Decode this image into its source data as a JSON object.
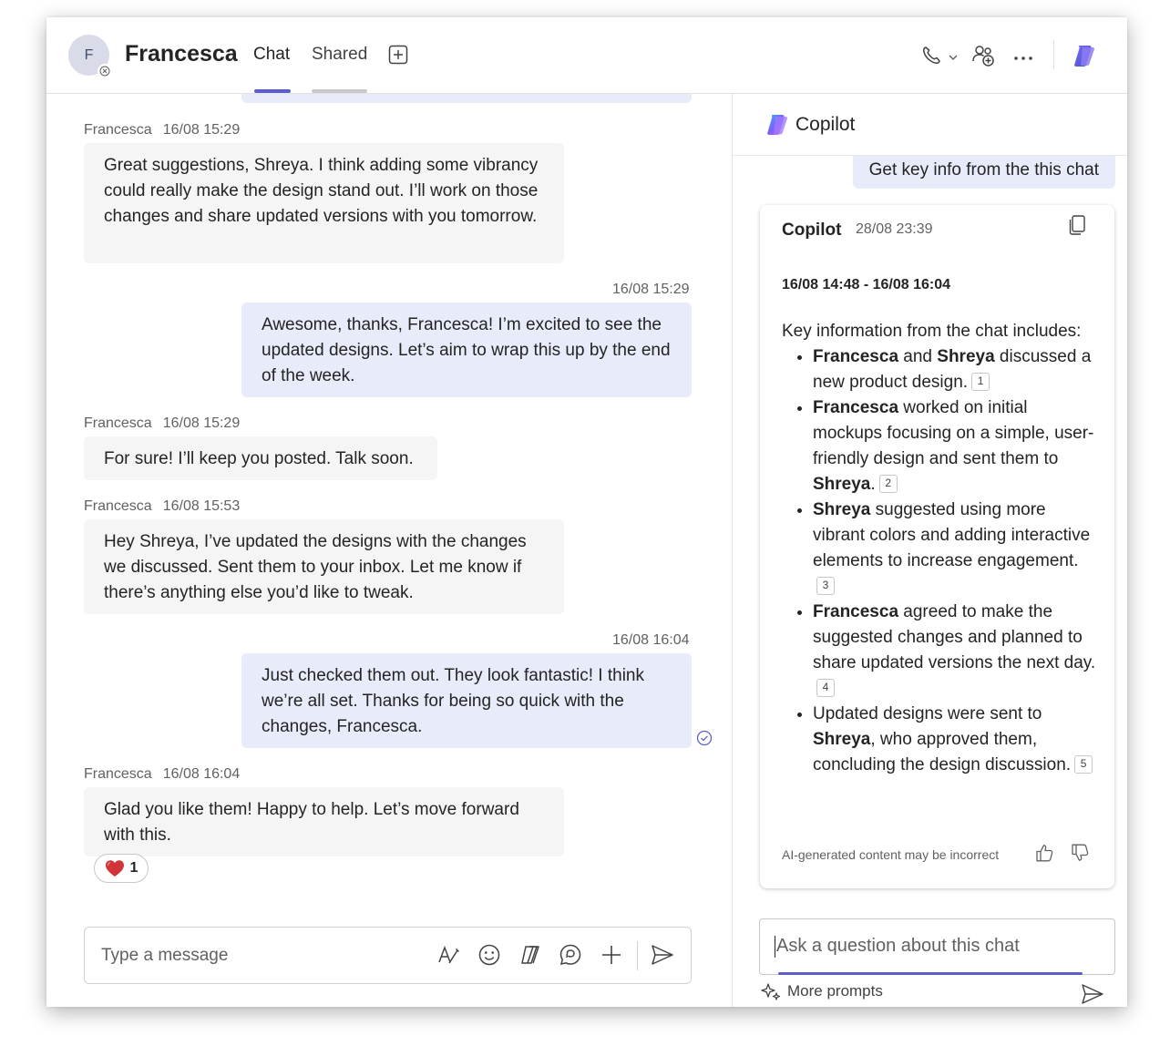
{
  "header": {
    "avatar_initial": "F",
    "contact_name": "Francesca",
    "tabs": [
      {
        "label": "Chat",
        "active": true
      },
      {
        "label": "Shared",
        "active": false
      }
    ],
    "icons": [
      "add-tab-icon",
      "phone-icon",
      "chevron-down-icon",
      "add-people-icon",
      "more-icon",
      "copilot-icon"
    ]
  },
  "chat": {
    "messages": [
      {
        "sender": "Francesca",
        "time": "16/08 15:29",
        "direction": "in",
        "text": "Great suggestions, Shreya. I think adding some vibrancy could really make the design stand out. I’ll work on those changes and share updated versions with you tomorrow."
      },
      {
        "sender": "",
        "time": "16/08 15:29",
        "direction": "out",
        "text": "Awesome, thanks, Francesca! I’m excited to see the updated designs. Let’s aim to wrap this up by the end of the week."
      },
      {
        "sender": "Francesca",
        "time": "16/08 15:29",
        "direction": "in",
        "text": "For sure! I’ll keep you posted. Talk soon."
      },
      {
        "sender": "Francesca",
        "time": "16/08 15:53",
        "direction": "in",
        "text": "Hey Shreya, I’ve updated the designs with the changes we discussed. Sent them to your inbox. Let me know if there’s anything else you’d like to tweak."
      },
      {
        "sender": "",
        "time": "16/08 16:04",
        "direction": "out",
        "text": "Just checked them out. They look fantastic! I think we’re all set. Thanks for being so quick with the changes, Francesca."
      },
      {
        "sender": "Francesca",
        "time": "16/08 16:04",
        "direction": "in",
        "text": "Glad you like them! Happy to help. Let’s move forward with this."
      }
    ],
    "reaction": {
      "emoji": "heart",
      "count": "1"
    },
    "composer": {
      "placeholder": "Type a message"
    }
  },
  "copilot": {
    "title": "Copilot",
    "user_prompt": "Get key info from the this chat",
    "response": {
      "name": "Copilot",
      "time": "28/08 23:39",
      "range": "16/08 14:48 - 16/08 16:04",
      "intro": "Key information from the chat includes:",
      "bullets": [
        {
          "parts": [
            {
              "b": "Francesca"
            },
            {
              "t": " and "
            },
            {
              "b": "Shreya"
            },
            {
              "t": " discussed a new product design."
            }
          ],
          "cite": "1"
        },
        {
          "parts": [
            {
              "b": "Francesca"
            },
            {
              "t": " worked on initial mockups focusing on a simple, user-friendly design and sent them to "
            },
            {
              "b": "Shreya"
            },
            {
              "t": "."
            }
          ],
          "cite": "2"
        },
        {
          "parts": [
            {
              "b": "Shreya"
            },
            {
              "t": " suggested using more vibrant colors and adding interactive elements to increase engagement."
            }
          ],
          "cite": "3"
        },
        {
          "parts": [
            {
              "b": "Francesca"
            },
            {
              "t": " agreed to make the suggested changes and planned to share updated versions the next day."
            }
          ],
          "cite": "4"
        },
        {
          "parts": [
            {
              "t": "Updated designs were sent to "
            },
            {
              "b": "Shreya"
            },
            {
              "t": ", who approved them, concluding the design discussion."
            }
          ],
          "cite": "5"
        }
      ],
      "disclaimer": "AI-generated content may be incorrect"
    },
    "ask_placeholder": "Ask a question about this chat",
    "more_prompts": "More prompts"
  },
  "colors": {
    "accent": "#5b5fc7",
    "incoming_bubble": "#f5f5f5",
    "outgoing_bubble": "#e8ebfa",
    "tab_inactive_underline": "#c8c8c8"
  }
}
